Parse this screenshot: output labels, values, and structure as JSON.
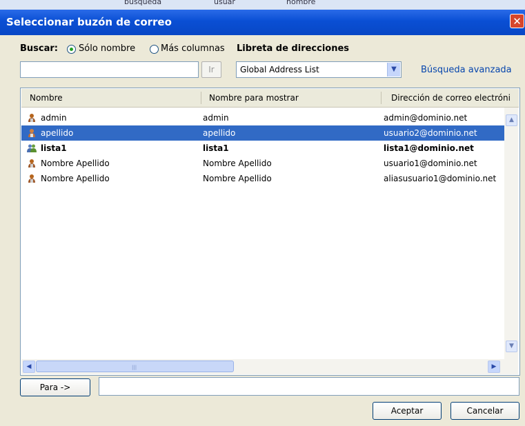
{
  "window": {
    "title": "Seleccionar buzón de correo",
    "close_glyph": "✕"
  },
  "background_strip": [
    "búsqueda",
    "usuar",
    "nombre"
  ],
  "search": {
    "label": "Buscar:",
    "option_name_only": "Sólo nombre",
    "option_more_columns": "Más columnas",
    "selected_option": "Sólo nombre",
    "query_value": "",
    "go_button": "Ir"
  },
  "address_book": {
    "label": "Libreta de direcciones",
    "selected": "Global Address List",
    "advanced_search_link": "Búsqueda avanzada"
  },
  "table": {
    "columns": [
      "Nombre",
      "Nombre para mostrar",
      "Dirección de correo electróni"
    ],
    "rows": [
      {
        "name": "admin",
        "display": "admin",
        "email": "admin@dominio.net",
        "type": "user",
        "selected": false,
        "bold": false
      },
      {
        "name": "apellido",
        "display": "apellido",
        "email": "usuario2@dominio.net",
        "type": "user",
        "selected": true,
        "bold": false
      },
      {
        "name": "lista1",
        "display": "lista1",
        "email": "lista1@dominio.net",
        "type": "group",
        "selected": false,
        "bold": true
      },
      {
        "name": "Nombre Apellido",
        "display": "Nombre Apellido",
        "email": "usuario1@dominio.net",
        "type": "user",
        "selected": false,
        "bold": false
      },
      {
        "name": "Nombre Apellido",
        "display": "Nombre Apellido",
        "email": "aliasusuario1@dominio.net",
        "type": "user",
        "selected": false,
        "bold": false
      }
    ]
  },
  "to_field": {
    "button": "Para ->",
    "value": ""
  },
  "buttons": {
    "ok": "Aceptar",
    "cancel": "Cancelar"
  },
  "colors": {
    "titlebar": "#0a4fd4",
    "selection": "#316ac5",
    "dialog_bg": "#ece9d8",
    "link": "#0645ad"
  }
}
